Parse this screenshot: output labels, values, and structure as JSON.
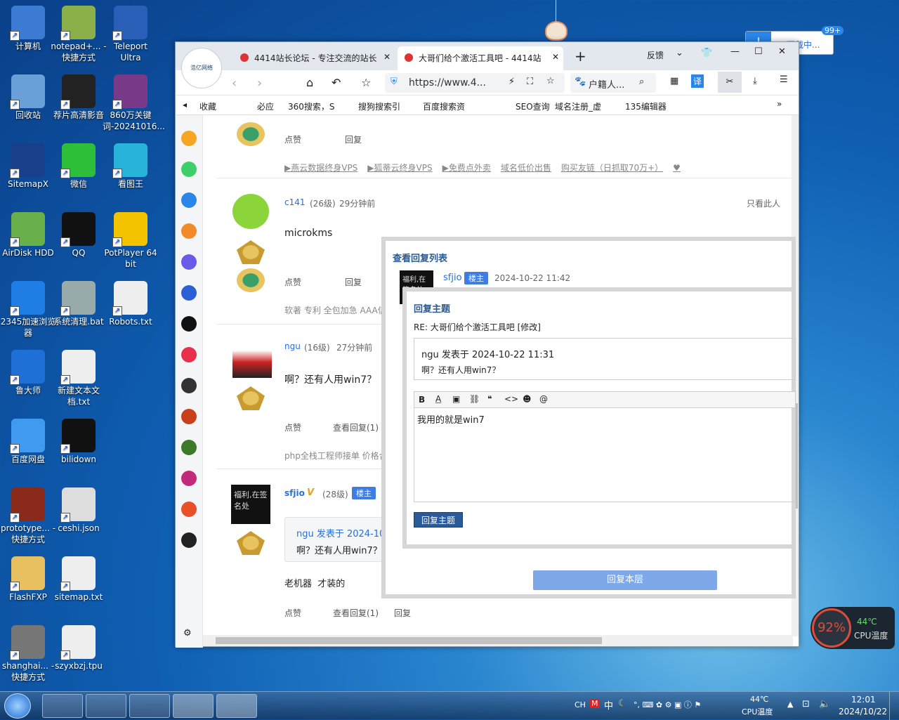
{
  "desktop": {
    "icons": [
      {
        "label": "计算机",
        "c": "#3b7bd4"
      },
      {
        "label": "notepad+... - 快捷方式",
        "c": "#8bb04a"
      },
      {
        "label": "Teleport Ultra",
        "c": "#2a5fb8"
      },
      {
        "label": "回收站",
        "c": "#6aa0d8"
      },
      {
        "label": "荐片高清影音",
        "c": "#222"
      },
      {
        "label": "860万关键词-20241016...",
        "c": "#7a3a8a"
      },
      {
        "label": "SitemapX",
        "c": "#1a3f8a"
      },
      {
        "label": "微信",
        "c": "#2dbe3a"
      },
      {
        "label": "看图王",
        "c": "#28b4d8"
      },
      {
        "label": "AirDisk HDD",
        "c": "#6ab04a"
      },
      {
        "label": "QQ",
        "c": "#111"
      },
      {
        "label": "PotPlayer 64 bit",
        "c": "#f4c300"
      },
      {
        "label": "2345加速浏览器",
        "c": "#1e7ee6"
      },
      {
        "label": "系统清理.bat",
        "c": "#9aa"
      },
      {
        "label": "Robots.txt",
        "c": "#eee"
      },
      {
        "label": "鲁大师",
        "c": "#1e6fd6"
      },
      {
        "label": "新建文本文档.txt",
        "c": "#eee"
      },
      {
        "label": "百度网盘",
        "c": "#3f9af0"
      },
      {
        "label": "bilidown",
        "c": "#111"
      },
      {
        "label": "prototype... - 快捷方式",
        "c": "#8a2a1a"
      },
      {
        "label": "ceshi.json",
        "c": "#ddd"
      },
      {
        "label": "FlashFXP",
        "c": "#e8c060"
      },
      {
        "label": "sitemap.txt",
        "c": "#eee"
      },
      {
        "label": "shanghai... - 快捷方式",
        "c": "#777"
      },
      {
        "label": "szyxbzj.tpu",
        "c": "#eee"
      }
    ]
  },
  "download_widget": {
    "label": "下载中...",
    "count": "99+"
  },
  "browser": {
    "tabs": [
      {
        "title": "4414站长论坛 - 专注交流的站长"
      },
      {
        "title": "大哥们给个激活工具吧 - 4414站"
      }
    ],
    "feedback": "反馈",
    "address": "https://www.4...",
    "search_placeholder": "户籍人...",
    "translate": "译",
    "bookmarks": [
      "收藏",
      "必应",
      "360搜索，S",
      "搜狗搜索引",
      "百度搜索资",
      "SEO查询",
      "域名注册_虚",
      "135编辑器"
    ]
  },
  "forum": {
    "post0": {
      "like": "点赞",
      "reply": "回复",
      "ads": [
        "▶燕云数据终身VPS",
        "▶狐蒂云终身VPS",
        "▶免费点外卖",
        "域名低价出售",
        "购买友链（日抓取70万+）",
        "♥"
      ]
    },
    "post1": {
      "user": "c141",
      "level": "(26级)",
      "time": "29分钟前",
      "only": "只看此人",
      "body": "microkms",
      "like": "点赞",
      "reply": "回复",
      "sig": "软著 专利 全包加急 AAA信"
    },
    "post2": {
      "user": "ngu",
      "level": "(16级)",
      "time": "27分钟前",
      "body": "啊？还有人用win7？",
      "like": "点赞",
      "view": "查看回复(1)",
      "sig": "php全栈工程师接单 价格合"
    },
    "post3": {
      "user": "sfjio",
      "level": "(28级)",
      "badge": "楼主",
      "quote_head": "ngu 发表于 2024-10-",
      "quote_body": "啊？还有人用win7？",
      "body": "老机器  才装的",
      "like": "点赞",
      "view": "查看回复(1)",
      "reply": "回复",
      "avatar_text": "福利,在签名处"
    }
  },
  "popup": {
    "title": "查看回复列表",
    "user": "sfjio",
    "badge": "楼主",
    "time": "2024-10-22 11:42",
    "avatar_text": "福利,在签名处",
    "inner_title": "回复主题",
    "re": "RE: 大哥们给个激活工具吧 [修改]",
    "quote_head": "ngu 发表于 2024-10-22 11:31",
    "quote_body": "啊？还有人用win7？",
    "editor_text": "我用的就是win7",
    "submit": "回复主题",
    "reply_floor": "回复本层"
  },
  "cpu_widget": {
    "percent": "92%",
    "temp": "44℃",
    "label": "CPU温度"
  },
  "taskbar": {
    "ime": "CH",
    "ime2": "中",
    "temp": "44℃",
    "temp_label": "CPU温度",
    "time": "12:01",
    "date": "2024/10/22"
  }
}
